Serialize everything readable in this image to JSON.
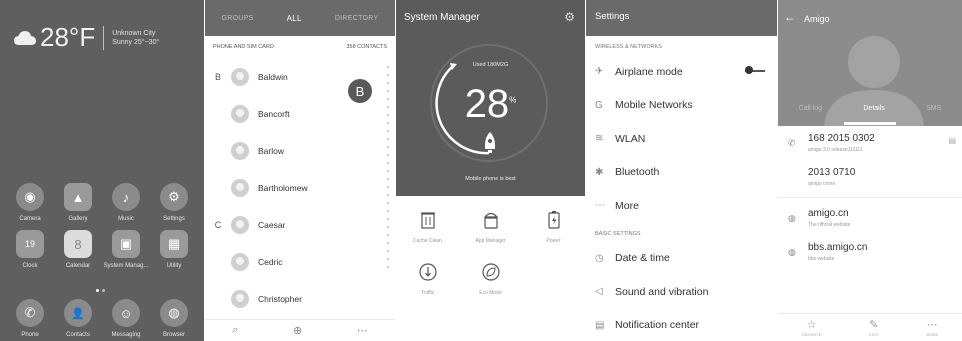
{
  "home": {
    "weather": {
      "temp": "28°F",
      "city": "Unknown City",
      "condition": "Sunny 25°~30°",
      "icon": "cloud-icon"
    },
    "apps": [
      {
        "label": "Camera",
        "icon": "camera-icon",
        "glyph": "◉"
      },
      {
        "label": "Gallery",
        "icon": "gallery-icon",
        "glyph": "▲"
      },
      {
        "label": "Music",
        "icon": "music-icon",
        "glyph": "♪"
      },
      {
        "label": "Settings",
        "icon": "gear-icon",
        "glyph": "⚙"
      },
      {
        "label": "Clock",
        "icon": "clock-icon",
        "glyph": "19"
      },
      {
        "label": "Calendar",
        "icon": "calendar-icon",
        "glyph": "8"
      },
      {
        "label": "System Manag...",
        "icon": "system-manager-icon",
        "glyph": "▣"
      },
      {
        "label": "Utility",
        "icon": "utility-icon",
        "glyph": "▦"
      }
    ],
    "dock": [
      {
        "label": "Phone",
        "icon": "phone-icon",
        "glyph": "✆"
      },
      {
        "label": "Contacts",
        "icon": "contacts-icon",
        "glyph": "👤"
      },
      {
        "label": "Messaging",
        "icon": "messaging-icon",
        "glyph": "☺"
      },
      {
        "label": "Browser",
        "icon": "browser-icon",
        "glyph": "◍"
      }
    ]
  },
  "contacts": {
    "tabs": [
      "GROUPS",
      "ALL",
      "DIRECTORY"
    ],
    "header_left": "PHONE AND SIM CARD",
    "header_right": "358 CONTACTS",
    "badge": "B",
    "rows": [
      {
        "letter": "B",
        "name": "Baldwin"
      },
      {
        "letter": "",
        "name": "Bancorft"
      },
      {
        "letter": "",
        "name": "Barlow"
      },
      {
        "letter": "",
        "name": "Bartholomew"
      },
      {
        "letter": "C",
        "name": "Caesar"
      },
      {
        "letter": "",
        "name": "Cedric"
      },
      {
        "letter": "",
        "name": "Christopher"
      }
    ],
    "bottom": [
      "⌕",
      "⊕",
      "⋯"
    ]
  },
  "system_manager": {
    "title": "System Manager",
    "used": "Used 180M2G",
    "score": "28",
    "score_unit": "%",
    "note": "Mobile phone is best",
    "tools": [
      {
        "label": "Cache Clean",
        "icon": "trash-icon",
        "glyph": "🗑"
      },
      {
        "label": "App Manager",
        "icon": "android-icon",
        "glyph": "▢"
      },
      {
        "label": "Power",
        "icon": "battery-icon",
        "glyph": "⚡"
      },
      {
        "label": "Traffic",
        "icon": "traffic-icon",
        "glyph": "◔"
      },
      {
        "label": "Eco Mode",
        "icon": "leaf-icon",
        "glyph": "❦"
      }
    ]
  },
  "settings": {
    "title": "Settings",
    "section1": "WIRELESS & NETWORKS",
    "wireless": [
      {
        "label": "Airplane mode",
        "icon": "airplane-icon",
        "glyph": "✈"
      },
      {
        "label": "Mobile Networks",
        "icon": "mobile-networks-icon",
        "glyph": "G"
      },
      {
        "label": "WLAN",
        "icon": "wifi-icon",
        "glyph": "≋"
      },
      {
        "label": "Bluetooth",
        "icon": "bluetooth-icon",
        "glyph": "✱"
      },
      {
        "label": "More",
        "icon": "more-icon",
        "glyph": "⋯"
      }
    ],
    "section2": "BASIC SETTINGS",
    "basic": [
      {
        "label": "Date & time",
        "icon": "clock-icon",
        "glyph": "◷"
      },
      {
        "label": "Sound and vibration",
        "icon": "sound-icon",
        "glyph": "◁"
      },
      {
        "label": "Notification center",
        "icon": "notification-icon",
        "glyph": "▤"
      }
    ]
  },
  "detail": {
    "name": "Amigo",
    "tabs": [
      "Call log",
      "Details",
      "SMS"
    ],
    "entries": [
      {
        "main": "168 2015 0302",
        "sub": "amigo 3.0 release111111",
        "icon": "phone-icon",
        "glyph": "✆",
        "extra": "▤"
      },
      {
        "main": "2013 0710",
        "sub": "amigo come",
        "icon": "",
        "glyph": "",
        "extra": ""
      },
      {
        "main": "amigo.cn",
        "sub": "The official website",
        "icon": "globe-icon",
        "glyph": "◍",
        "extra": ""
      },
      {
        "main": "bbs.amigo.cn",
        "sub": "bbs website",
        "icon": "globe-icon",
        "glyph": "◍",
        "extra": ""
      }
    ],
    "bottom": [
      {
        "label": "FAVORITE",
        "icon": "star-icon",
        "glyph": "☆"
      },
      {
        "label": "EDIT",
        "icon": "edit-icon",
        "glyph": "✎"
      },
      {
        "label": "MORE",
        "icon": "more-icon",
        "glyph": "⋯"
      }
    ]
  }
}
